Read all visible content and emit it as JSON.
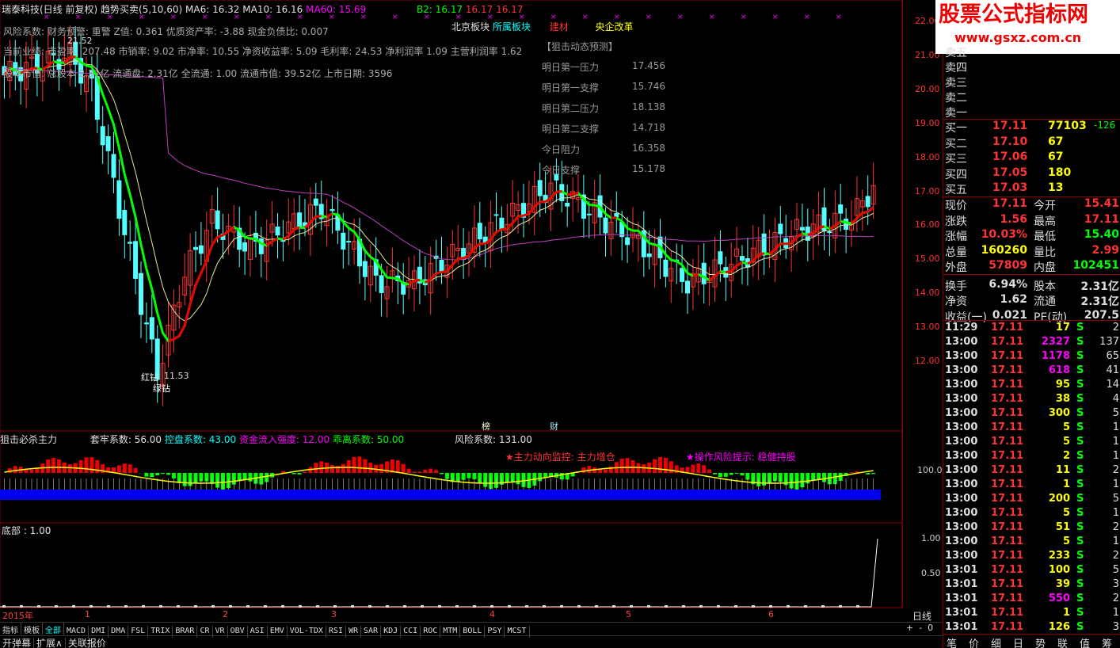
{
  "header": {
    "stock": "瑞泰科技(日线 前复权)",
    "formula": "趋势买卖(5,10,60)",
    "ma6": "MA6: 16.32",
    "ma10": "MA10: 16.16",
    "ma60": "MA60: 15.69",
    "b2": "B2: 16.17",
    "v2": "16.17",
    "v3": "16.17"
  },
  "info": {
    "line1": "风险系数: 财务预警: 重警 Z值: 0.361 优质资产率: -3.88 现金负债比: 0.007",
    "line2": "当前业绩: 市盈率: 207.48 市销率: 9.02 市净率: 10.55 净资收益率: 5.09 毛利率: 24.53 净利润率 1.09 主营利润率 1.62",
    "line3": "股本市值: 总股本 2.31亿 流通盘: 2.31亿 全流通: 1.00 流通市值: 39.52亿 上市日期: 3596"
  },
  "sectors": [
    "北京板块",
    "所属板块",
    "建材",
    "央企改革"
  ],
  "forecast": {
    "title": "【狙击动态预测】",
    "rows": [
      [
        "明日第一压力",
        "17.456"
      ],
      [
        "明日第一支撑",
        "15.746"
      ],
      [
        "明日第二压力",
        "18.138"
      ],
      [
        "明日第二支撑",
        "14.718"
      ],
      [
        "今日阻力",
        "16.358"
      ],
      [
        "今日支撑",
        "15.178"
      ]
    ]
  },
  "price_axis": [
    "22.00",
    "21.00",
    "20.00",
    "19.00",
    "18.00",
    "17.00",
    "16.00",
    "15.00",
    "14.00",
    "13.00",
    "12.00"
  ],
  "annot": {
    "high": "21.52",
    "low": "11.53",
    "red": "红钻",
    "green": "绿钻",
    "bang": "榜",
    "cai": "财"
  },
  "mid": {
    "title": "狙击必杀主力",
    "a": "套牢系数: 56.00",
    "b": "控盘系数: 43.00",
    "c": "资金流入强度: 12.00",
    "d": "乖离系数: 50.00",
    "e": "风险系数: 131.00",
    "watch": "★主力动向监控: 主力增仓",
    "risk": "★操作风险提示: 稳健持股",
    "axis": "100.0"
  },
  "low": {
    "title": "底部 : 1.00",
    "axis1": "1.00",
    "axis2": "0.50"
  },
  "xaxis": {
    "year": "2015年",
    "m": [
      "1",
      "2",
      "3",
      "4",
      "5",
      "6"
    ],
    "period": "日线"
  },
  "tabs": [
    "指标",
    "模板",
    "全部",
    "MACD",
    "DMI",
    "DMA",
    "FSL",
    "TRIX",
    "BRAR",
    "CR",
    "VR",
    "OBV",
    "ASI",
    "EMV",
    "VOL-TDX",
    "RSI",
    "WR",
    "SAR",
    "KDJ",
    "CCI",
    "ROC",
    "MTM",
    "BOLL",
    "PSY",
    "MCST"
  ],
  "bottom": [
    "开弹幕",
    "扩展∧",
    "关联报价"
  ],
  "logo": {
    "cn": "股票公式指标网",
    "url": "www.gsxz.com.cn"
  },
  "sell": [
    "卖五",
    "卖四",
    "卖三",
    "卖二",
    "卖一"
  ],
  "buy": [
    [
      "买一",
      "17.11",
      "77103",
      "-126"
    ],
    [
      "买二",
      "17.10",
      "67",
      ""
    ],
    [
      "买三",
      "17.06",
      "67",
      ""
    ],
    [
      "买四",
      "17.05",
      "180",
      ""
    ],
    [
      "买五",
      "17.03",
      "13",
      ""
    ]
  ],
  "quote": [
    [
      "现价",
      "17.11",
      "今开",
      "15.41"
    ],
    [
      "涨跌",
      "1.56",
      "最高",
      "17.11"
    ],
    [
      "涨幅",
      "10.03%",
      "最低",
      "15.40"
    ],
    [
      "总量",
      "160260",
      "量比",
      "2.99"
    ],
    [
      "外盘",
      "57809",
      "内盘",
      "102451"
    ],
    [
      "换手",
      "6.94%",
      "股本",
      "2.31亿"
    ],
    [
      "净资",
      "1.62",
      "流通",
      "2.31亿"
    ],
    [
      "收益(一)",
      "0.021",
      "PE(动)",
      "207.5"
    ]
  ],
  "ticks": [
    [
      "11:29",
      "17.11",
      "17",
      "S",
      "2"
    ],
    [
      "13:00",
      "17.11",
      "2327",
      "S",
      "137"
    ],
    [
      "13:00",
      "17.11",
      "1178",
      "S",
      "65"
    ],
    [
      "13:00",
      "17.11",
      "618",
      "S",
      "41"
    ],
    [
      "13:00",
      "17.11",
      "95",
      "S",
      "14"
    ],
    [
      "13:00",
      "17.11",
      "38",
      "S",
      "4"
    ],
    [
      "13:00",
      "17.11",
      "300",
      "S",
      "5"
    ],
    [
      "13:00",
      "17.11",
      "5",
      "S",
      "1"
    ],
    [
      "13:00",
      "17.11",
      "5",
      "S",
      "1"
    ],
    [
      "13:00",
      "17.11",
      "2",
      "S",
      "1"
    ],
    [
      "13:00",
      "17.11",
      "11",
      "S",
      "2"
    ],
    [
      "13:00",
      "17.11",
      "1",
      "S",
      "1"
    ],
    [
      "13:00",
      "17.11",
      "200",
      "S",
      "5"
    ],
    [
      "13:00",
      "17.11",
      "5",
      "S",
      "1"
    ],
    [
      "13:00",
      "17.11",
      "51",
      "S",
      "2"
    ],
    [
      "13:00",
      "17.11",
      "5",
      "S",
      "1"
    ],
    [
      "13:00",
      "17.11",
      "233",
      "S",
      "2"
    ],
    [
      "13:01",
      "17.11",
      "100",
      "S",
      "5"
    ],
    [
      "13:01",
      "17.11",
      "39",
      "S",
      "3"
    ],
    [
      "13:01",
      "17.11",
      "550",
      "S",
      "2"
    ],
    [
      "13:01",
      "17.11",
      "1",
      "S",
      "1"
    ],
    [
      "13:01",
      "17.11",
      "126",
      "S",
      "3"
    ]
  ],
  "ticktabs": [
    "笔",
    "价",
    "细",
    "日",
    "势",
    "联",
    "值",
    "筹"
  ]
}
